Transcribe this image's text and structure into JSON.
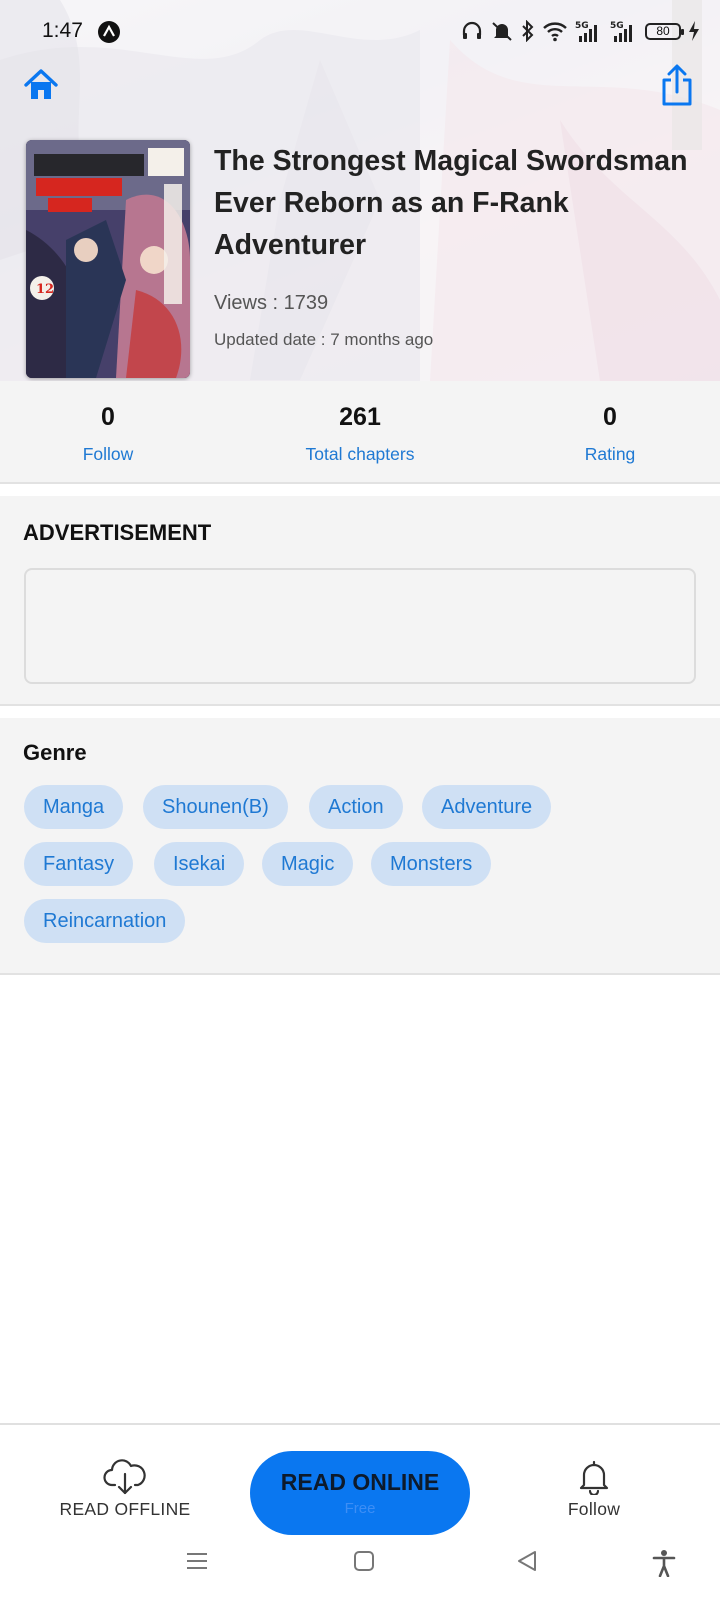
{
  "status_bar": {
    "time": "1:47",
    "battery": "80"
  },
  "manga": {
    "title": "The Strongest Magical Swordsman Ever Reborn as an F-Rank Adventurer",
    "views": "Views : 1739",
    "updated": "Updated date : 7 months ago",
    "cover_volume": "12"
  },
  "stats": [
    {
      "value": "0",
      "label": "Follow"
    },
    {
      "value": "261",
      "label": "Total chapters"
    },
    {
      "value": "0",
      "label": "Rating"
    }
  ],
  "advertisement": {
    "heading": "ADVERTISEMENT"
  },
  "genre": {
    "heading": "Genre",
    "tags": [
      "Manga",
      "Shounen(B)",
      "Action",
      "Adventure",
      "Fantasy",
      "Isekai",
      "Magic",
      "Monsters",
      "Reincarnation"
    ]
  },
  "bottom_bar": {
    "read_offline_label": "READ OFFLINE",
    "read_online_label": "READ ONLINE",
    "read_online_sub": "Free",
    "follow_label": "Follow"
  },
  "icons": {
    "home": "home-icon",
    "share": "share-icon",
    "download": "cloud-download-icon",
    "bell": "bell-icon"
  },
  "colors": {
    "accent": "#0a77f0",
    "link": "#1f79d3",
    "chip_bg": "#cfe0f4",
    "section_bg": "#f4f4f4"
  }
}
